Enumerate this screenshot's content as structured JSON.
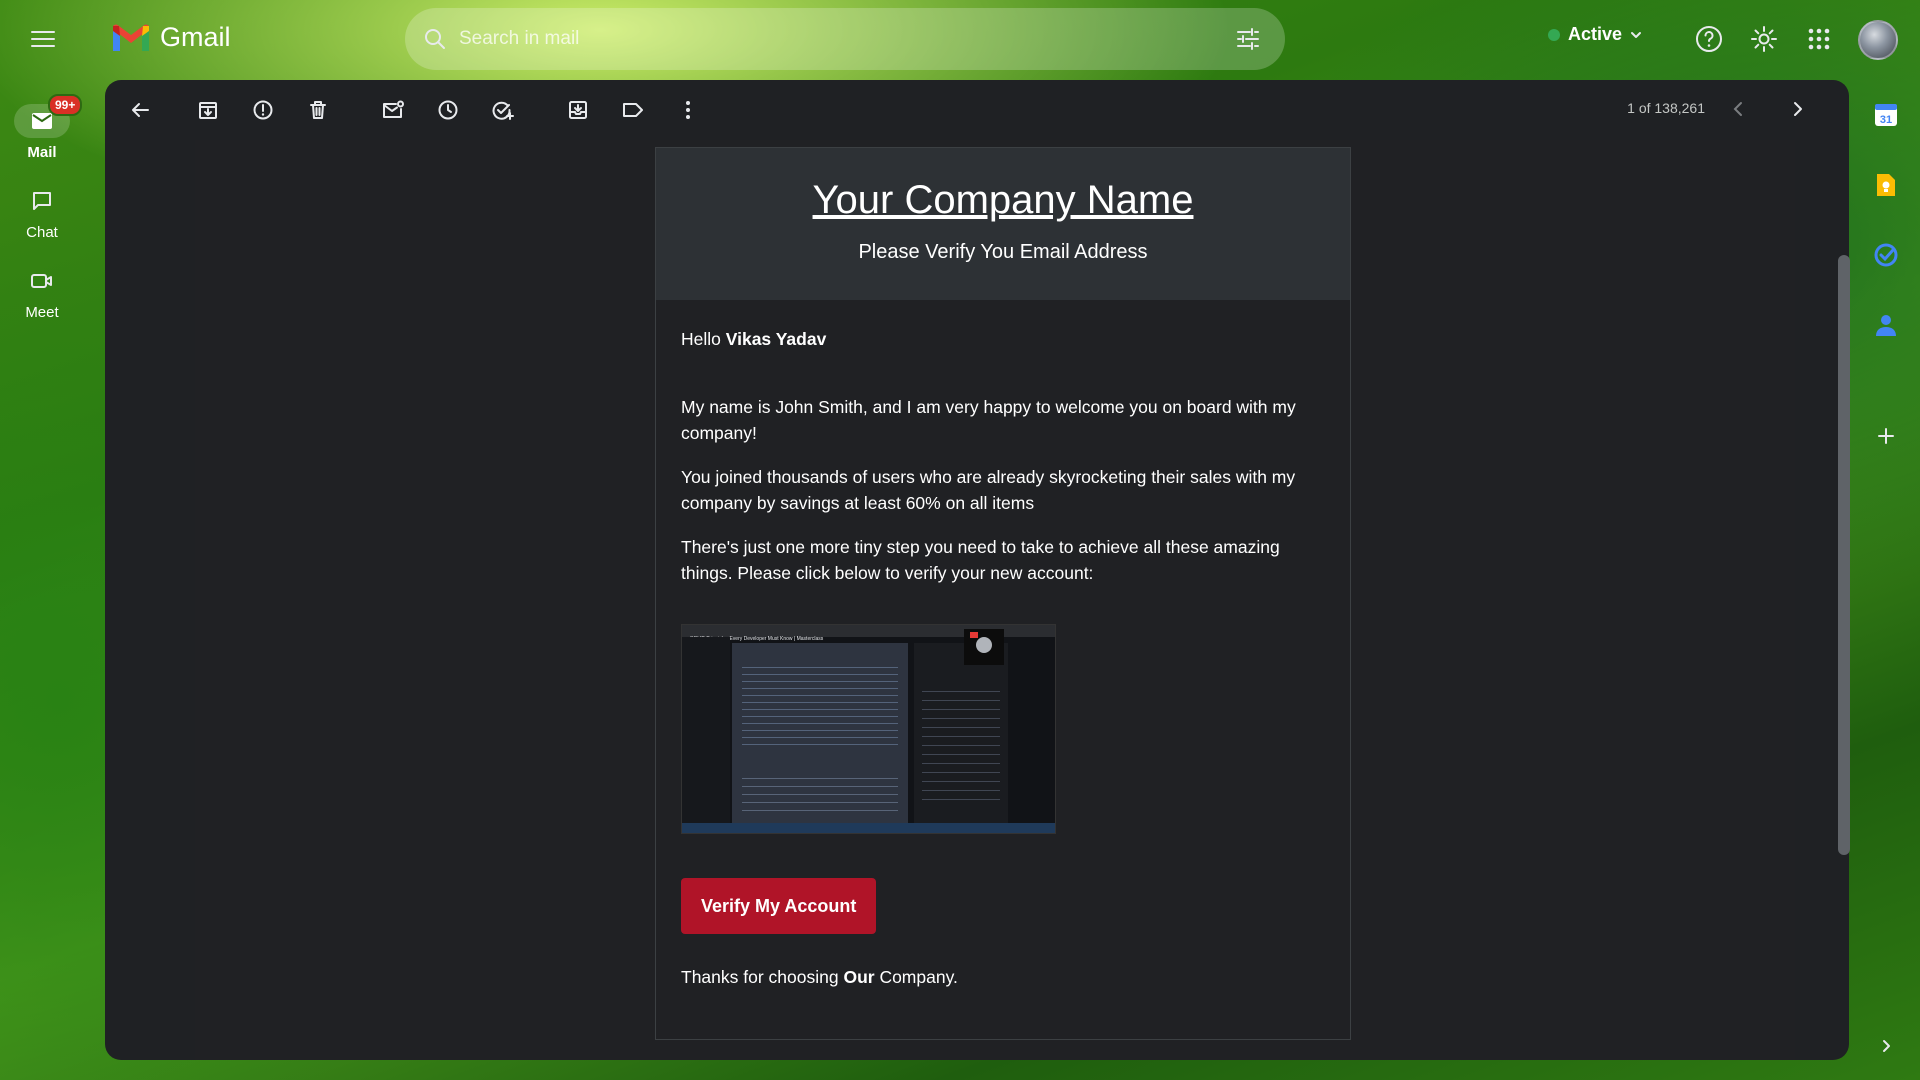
{
  "app": {
    "logo_text": "Gmail",
    "search_placeholder": "Search in mail",
    "status_label": "Active"
  },
  "left_rail": {
    "mail_label": "Mail",
    "mail_badge": "99+",
    "chat_label": "Chat",
    "meet_label": "Meet"
  },
  "toolbar": {
    "counter": "1 of 138,261"
  },
  "email": {
    "company_name": "Your Company Name",
    "header_sub": "Please Verify You Email Address",
    "greeting_prefix": "Hello ",
    "greeting_name": "Vikas Yadav",
    "para1": "My name is John Smith, and I am very happy to welcome you on board with my company!",
    "para2": "You joined thousands of users who are already skyrocketing their sales with my company by savings at least 60% on all items",
    "para3": "There's just one more tiny step you need to take to achieve all these amazing things. Please click below to verify your new account:",
    "image_title": "SOLID Principles Every Developer Must Know | Masterclass",
    "verify_button": "Verify My Account",
    "thanks_prefix": "Thanks for choosing ",
    "thanks_bold": "Our",
    "thanks_suffix": " Company."
  },
  "colors": {
    "accent_button": "#b01428",
    "active_dot": "#34a853",
    "badge": "#d93025",
    "panel_bg": "#1f2124",
    "email_header_bg": "#2d3135"
  },
  "icons": {
    "top": [
      "menu-icon",
      "search-icon",
      "filter-icon",
      "help-icon",
      "settings-icon",
      "apps-grid-icon"
    ],
    "toolbar": [
      "back-arrow-icon",
      "archive-icon",
      "report-spam-icon",
      "delete-icon",
      "mark-unread-icon",
      "snooze-icon",
      "add-task-icon",
      "move-to-icon",
      "label-icon",
      "more-vert-icon",
      "chevron-left-icon",
      "chevron-right-icon"
    ],
    "side": [
      "calendar-icon",
      "keep-icon",
      "tasks-icon",
      "contacts-icon",
      "add-icon",
      "expand-icon"
    ]
  }
}
